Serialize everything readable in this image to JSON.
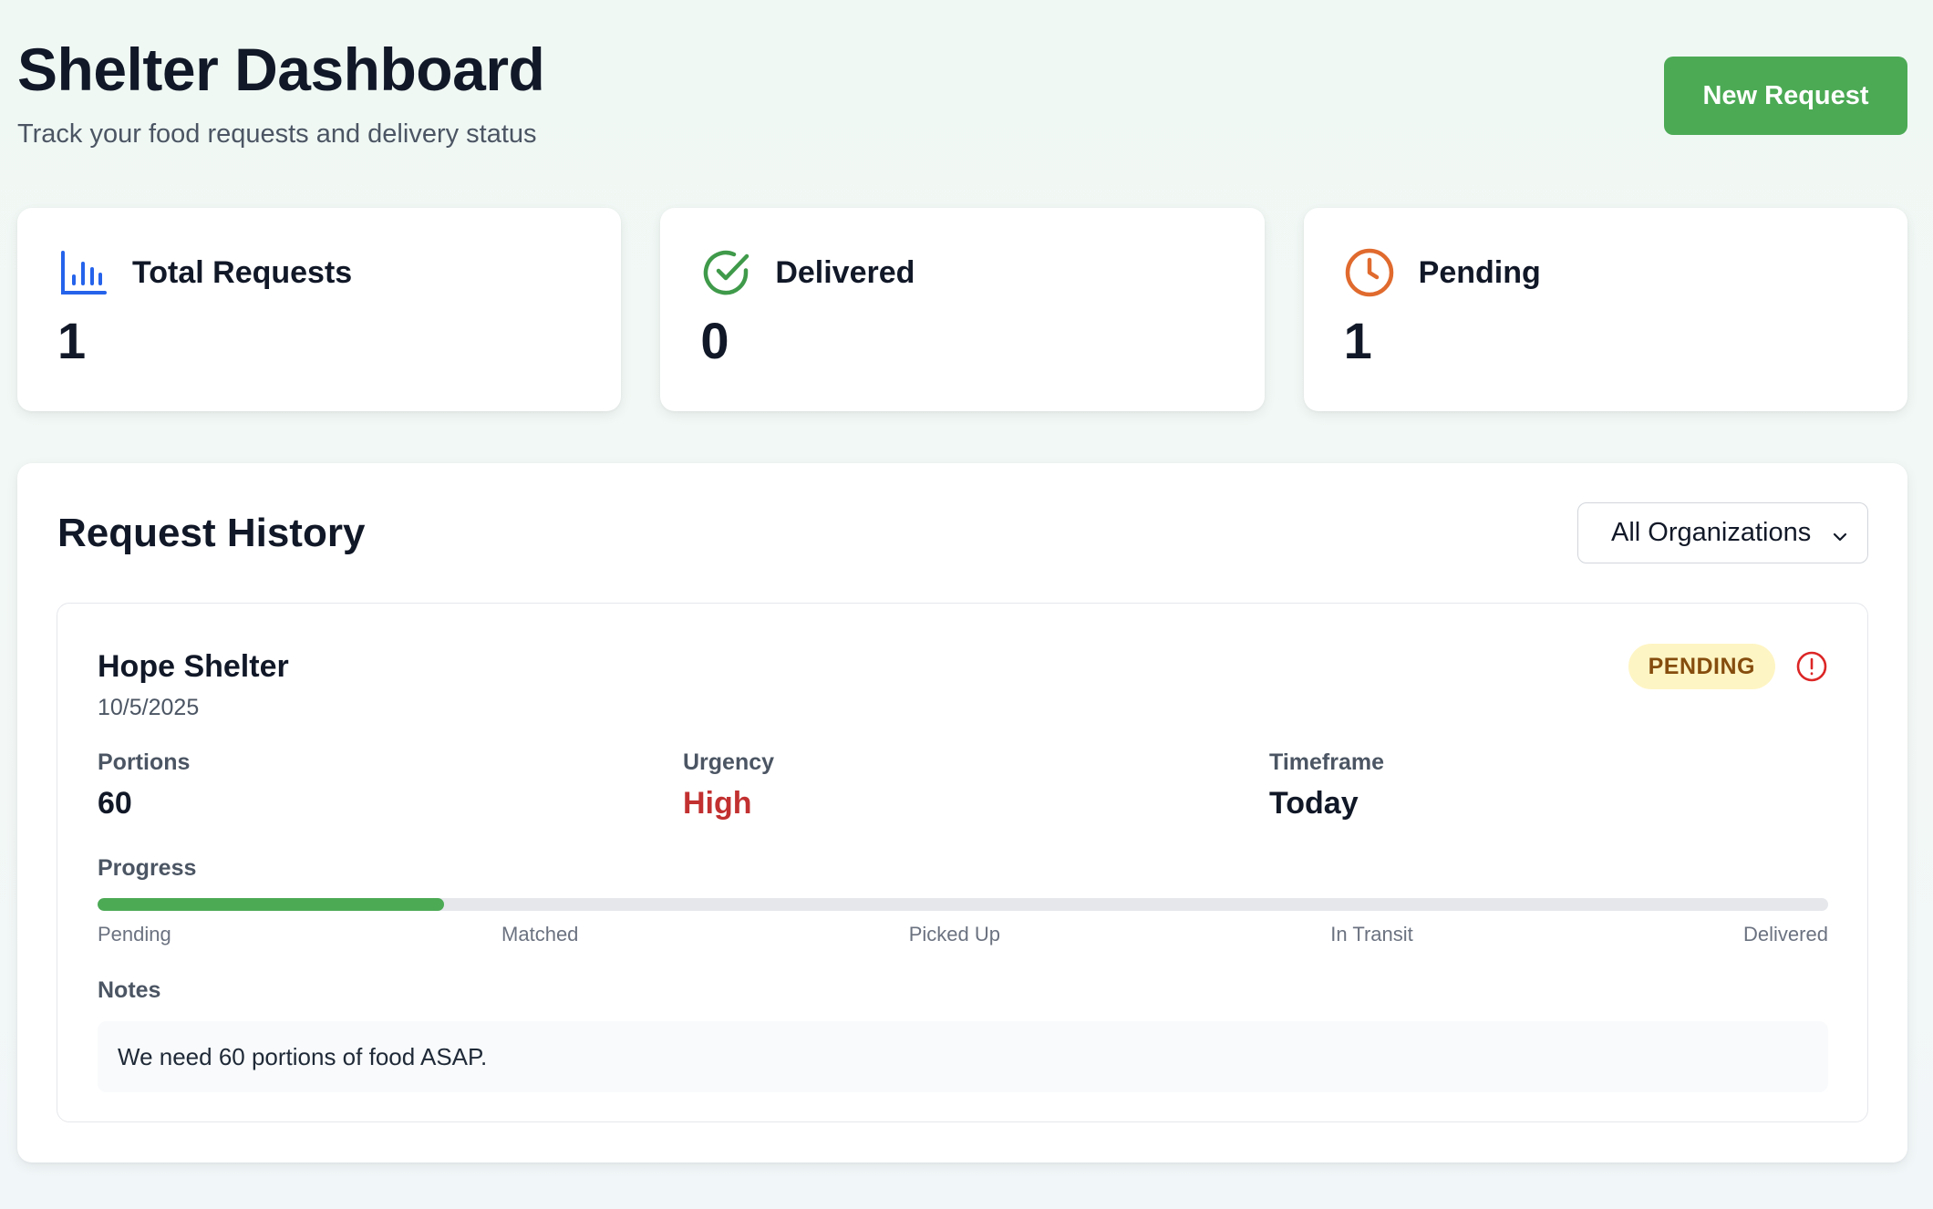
{
  "header": {
    "title": "Shelter Dashboard",
    "subtitle": "Track your food requests and delivery status",
    "new_request_label": "New Request"
  },
  "stats": [
    {
      "label": "Total Requests",
      "value": "1",
      "icon": "bar-chart-icon",
      "color": "#2563eb"
    },
    {
      "label": "Delivered",
      "value": "0",
      "icon": "check-circle-icon",
      "color": "#3f9a4a"
    },
    {
      "label": "Pending",
      "value": "1",
      "icon": "clock-icon",
      "color": "#e06a2e"
    }
  ],
  "history": {
    "title": "Request History",
    "filter": {
      "selected": "All Organizations",
      "icon": "chevron-down-icon"
    },
    "requests": [
      {
        "organization": "Hope Shelter",
        "date": "10/5/2025",
        "status": "PENDING",
        "status_icon": "alert-circle-icon",
        "fields": [
          {
            "label": "Portions",
            "value": "60"
          },
          {
            "label": "Urgency",
            "value": "High"
          },
          {
            "label": "Timeframe",
            "value": "Today"
          }
        ],
        "progress_label": "Progress",
        "progress_fraction": 0.2,
        "stages": [
          "Pending",
          "Matched",
          "Picked Up",
          "In Transit",
          "Delivered"
        ],
        "notes_label": "Notes",
        "notes": "We need 60 portions of food ASAP."
      }
    ]
  },
  "colors": {
    "accent_green": "#4caa55",
    "urgency_high": "#c23030",
    "badge_bg": "#fef5c4",
    "badge_text": "#854d0e",
    "alert_red": "#dc2626"
  }
}
